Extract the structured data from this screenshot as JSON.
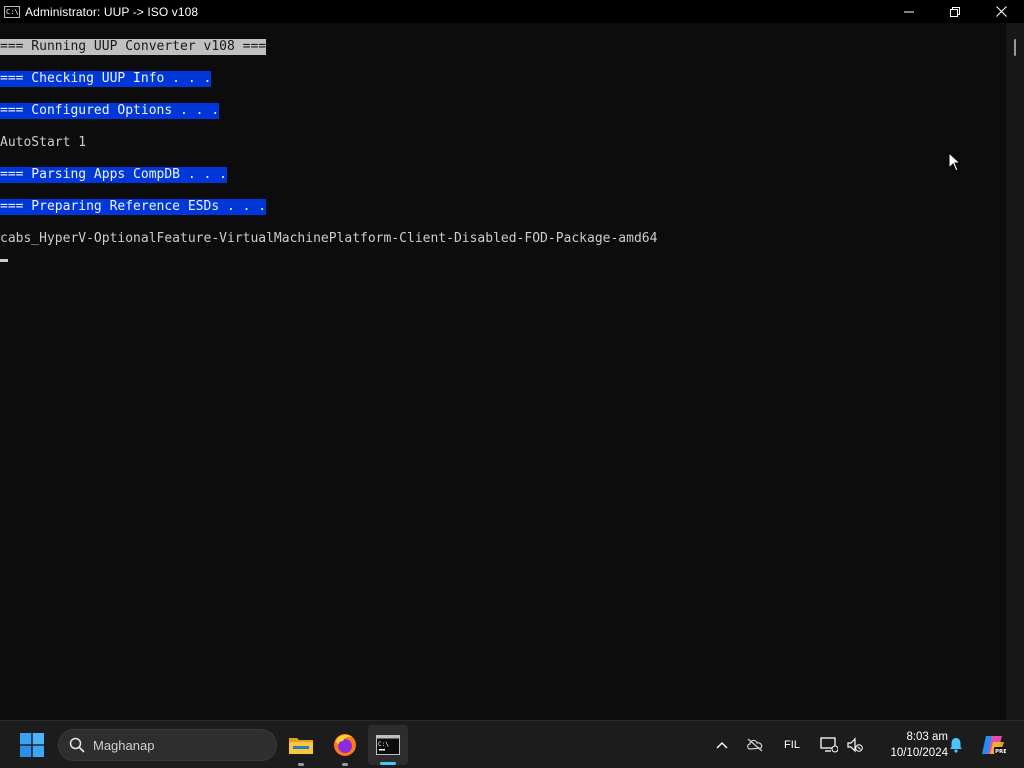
{
  "window": {
    "title": "Administrator:  UUP -> ISO v108",
    "icon": "console-icon",
    "controls": [
      "minimize-icon",
      "restore-icon",
      "close-icon"
    ]
  },
  "console": {
    "lines": [
      {
        "text": "=== Running UUP Converter v108 ===",
        "style": "highlight-gray"
      },
      {
        "text": "=== Checking UUP Info . . .",
        "style": "highlight-blue"
      },
      {
        "text": "=== Configured Options . . .",
        "style": "highlight-blue"
      },
      {
        "text": "AutoStart 1",
        "style": "plain"
      },
      {
        "text": "=== Parsing Apps CompDB . . .",
        "style": "highlight-blue"
      },
      {
        "text": "=== Preparing Reference ESDs . . .",
        "style": "highlight-blue"
      },
      {
        "text": "cabs_HyperV-OptionalFeature-VirtualMachinePlatform-Client-Disabled-FOD-Package-amd64",
        "style": "plain"
      }
    ],
    "colors": {
      "background": "#0c0c0c",
      "text": "#cccccc",
      "highlight_gray": "#c0c0c0",
      "highlight_blue": "#0037da"
    }
  },
  "taskbar": {
    "search_text": "Maghanap",
    "apps": [
      {
        "name": "File Explorer",
        "icon": "folder-icon",
        "running": true
      },
      {
        "name": "Firefox",
        "icon": "firefox-icon",
        "running": true
      },
      {
        "name": "Command Prompt",
        "icon": "terminal-icon",
        "running": true,
        "active": true
      }
    ],
    "tray": {
      "language": "FIL",
      "time": "8:03 am",
      "date": "10/10/2024"
    },
    "accent": "#4cc2ff"
  }
}
